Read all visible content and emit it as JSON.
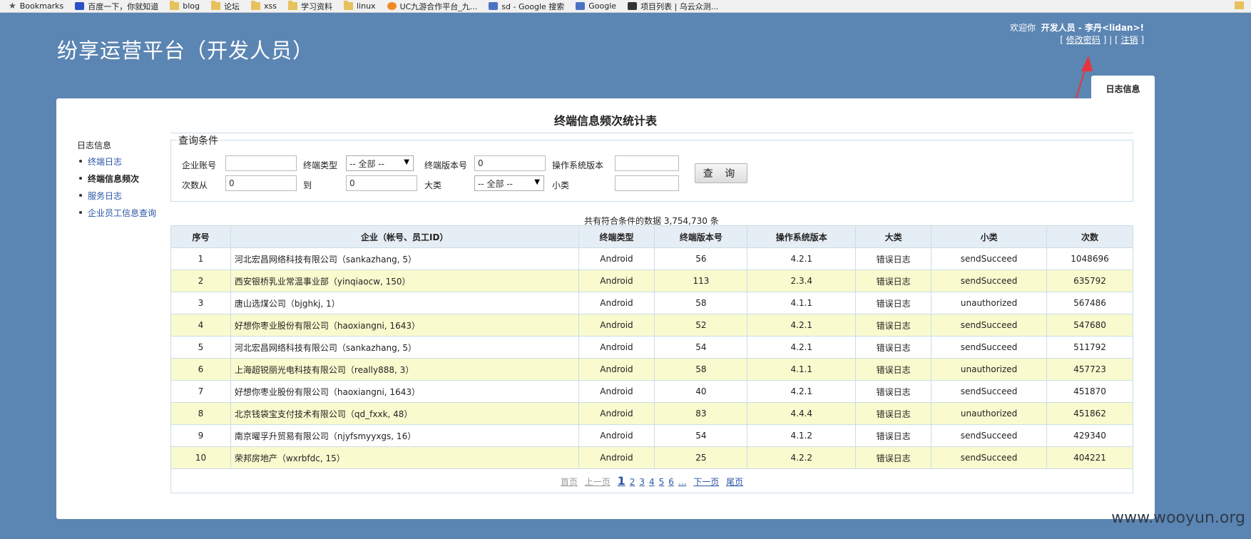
{
  "bookmarks": [
    {
      "label": "Bookmarks",
      "icon": "star-icon"
    },
    {
      "label": "百度一下，你就知道",
      "icon": "baidu-icon"
    },
    {
      "label": "blog",
      "icon": "folder-icon"
    },
    {
      "label": "论坛",
      "icon": "folder-icon"
    },
    {
      "label": "xss",
      "icon": "folder-icon"
    },
    {
      "label": "学习资料",
      "icon": "folder-icon"
    },
    {
      "label": "linux",
      "icon": "folder-icon"
    },
    {
      "label": "UC九游合作平台_九...",
      "icon": "uc-icon"
    },
    {
      "label": "sd - Google 搜索",
      "icon": "google-icon"
    },
    {
      "label": "Google",
      "icon": "google-icon"
    },
    {
      "label": "项目列表 | 乌云众测...",
      "icon": "wooyun-icon"
    }
  ],
  "header": {
    "site_title": "纷享运营平台（开发人员）",
    "welcome_prefix": "欢迎你",
    "welcome_user": "开发人员 - 李丹<lidan>",
    "welcome_suffix": "!",
    "change_password": "修改密码",
    "logout": "注销",
    "tab_label": "日志信息"
  },
  "page": {
    "title": "终端信息频次统计表"
  },
  "sidebar": {
    "heading": "日志信息",
    "items": [
      {
        "label": "终端日志",
        "active": false
      },
      {
        "label": "终端信息频次",
        "active": true
      },
      {
        "label": "服务日志",
        "active": false
      },
      {
        "label": "企业员工信息查询",
        "active": false
      }
    ]
  },
  "query": {
    "legend": "查询条件",
    "company_label": "企业账号",
    "company_value": "",
    "terminal_type_label": "终端类型",
    "terminal_type_value": "-- 全部 --",
    "terminal_version_label": "终端版本号",
    "terminal_version_value": "0",
    "os_version_label": "操作系统版本",
    "os_version_value": "",
    "count_from_label": "次数从",
    "count_from_value": "0",
    "count_to_label": "到",
    "count_to_value": "0",
    "category_label": "大类",
    "category_value": "-- 全部 --",
    "subcategory_label": "小类",
    "subcategory_value": "",
    "search_button": "查 询"
  },
  "summary": "共有符合条件的数据 3,754,730 条",
  "table": {
    "columns": [
      "序号",
      "企业（帐号、员工ID）",
      "终端类型",
      "终端版本号",
      "操作系统版本",
      "大类",
      "小类",
      "次数"
    ],
    "rows": [
      [
        "1",
        "河北宏昌网络科技有限公司（sankazhang, 5）",
        "Android",
        "56",
        "4.2.1",
        "错误日志",
        "sendSucceed",
        "1048696"
      ],
      [
        "2",
        "西安银桥乳业常温事业部（yinqiaocw, 150）",
        "Android",
        "113",
        "2.3.4",
        "错误日志",
        "sendSucceed",
        "635792"
      ],
      [
        "3",
        "唐山选煤公司（bjghkj, 1）",
        "Android",
        "58",
        "4.1.1",
        "错误日志",
        "unauthorized",
        "567486"
      ],
      [
        "4",
        "好想你枣业股份有限公司（haoxiangni, 1643）",
        "Android",
        "52",
        "4.2.1",
        "错误日志",
        "sendSucceed",
        "547680"
      ],
      [
        "5",
        "河北宏昌网络科技有限公司（sankazhang, 5）",
        "Android",
        "54",
        "4.2.1",
        "错误日志",
        "sendSucceed",
        "511792"
      ],
      [
        "6",
        "上海超锐丽光电科技有限公司（really888, 3）",
        "Android",
        "58",
        "4.1.1",
        "错误日志",
        "unauthorized",
        "457723"
      ],
      [
        "7",
        "好想你枣业股份有限公司（haoxiangni, 1643）",
        "Android",
        "40",
        "4.2.1",
        "错误日志",
        "sendSucceed",
        "451870"
      ],
      [
        "8",
        "北京钱袋宝支付技术有限公司（qd_fxxk, 48）",
        "Android",
        "83",
        "4.4.4",
        "错误日志",
        "unauthorized",
        "451862"
      ],
      [
        "9",
        "南京曜孚升贸易有限公司（njyfsmyyxgs, 16）",
        "Android",
        "54",
        "4.1.2",
        "错误日志",
        "sendSucceed",
        "429340"
      ],
      [
        "10",
        "荣邦房地产（wxrbfdc, 15）",
        "Android",
        "25",
        "4.2.2",
        "错误日志",
        "sendSucceed",
        "404221"
      ]
    ]
  },
  "pager": {
    "first": "首页",
    "prev": "上一页",
    "pages": [
      "1",
      "2",
      "3",
      "4",
      "5",
      "6",
      "..."
    ],
    "current": "1",
    "next": "下一页",
    "last": "尾页"
  },
  "watermark": "www.wooyun.org",
  "colors": {
    "background": "#5b85b3",
    "row_highlight": "#fafacf",
    "header_row": "#e6eef5",
    "annotation_arrow": "#e8343a"
  }
}
